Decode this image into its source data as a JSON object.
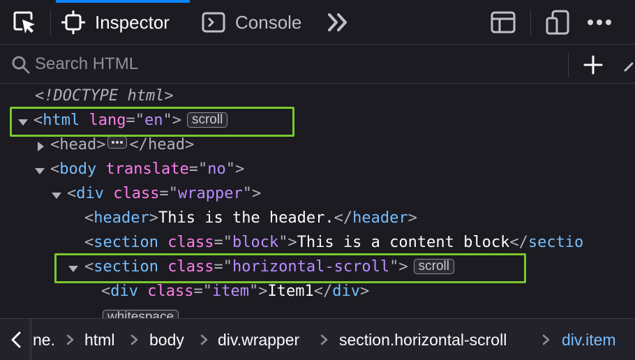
{
  "toolbar": {
    "tabs": [
      {
        "label": "Inspector",
        "active": true
      },
      {
        "label": "Console",
        "active": false
      }
    ],
    "accent_color": "#0a84ff",
    "icons": [
      "element-picker-icon",
      "inspector-icon",
      "console-icon",
      "overflow-chevrons-icon",
      "layout-panel-icon",
      "responsive-design-icon",
      "more-options-icon"
    ]
  },
  "search": {
    "placeholder": "Search HTML",
    "value": ""
  },
  "markup": {
    "doctype": "<!DOCTYPE html>",
    "html": {
      "tag": "html",
      "attr": "lang",
      "value": "en",
      "badge": "scroll"
    },
    "head": {
      "tag": "head"
    },
    "body": {
      "tag": "body",
      "attr": "translate",
      "value": "no"
    },
    "wrapper": {
      "tag": "div",
      "attr": "class",
      "value": "wrapper"
    },
    "header": {
      "tag": "header",
      "text": "This is the header."
    },
    "section_block": {
      "tag": "section",
      "attr": "class",
      "value": "block",
      "text": "This is a content block",
      "close_tag": "sectio"
    },
    "section_scroll": {
      "tag": "section",
      "attr": "class",
      "value": "horizontal-scroll",
      "badge": "scroll"
    },
    "item": {
      "tag": "div",
      "attr": "class",
      "value": "item",
      "text": "Item1"
    },
    "whitespace_badge": "whitespace",
    "highlight_color": "#79c92c"
  },
  "breadcrumbs": {
    "items": [
      "ne.",
      "html",
      "body",
      "div.wrapper",
      "section.horizontal-scroll",
      "div.item"
    ],
    "selected": "div.item"
  }
}
